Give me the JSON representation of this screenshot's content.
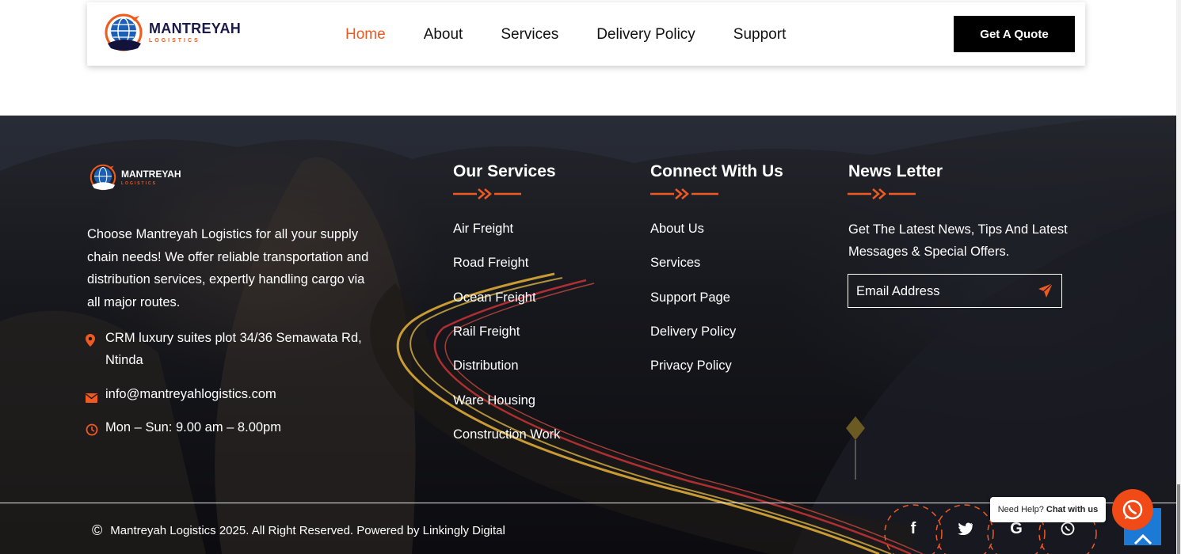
{
  "header": {
    "logo": {
      "title": "MANTREYAH",
      "subtitle": "LOGISTICS"
    },
    "nav": [
      "Home",
      "About",
      "Services",
      "Delivery Policy",
      "Support"
    ],
    "active_nav": "Home",
    "quote_button": "Get A Quote"
  },
  "footer": {
    "logo": {
      "title": "MANTREYAH",
      "subtitle": "LOGISTICS"
    },
    "about": "Choose Mantreyah Logistics for all your supply chain needs! We offer reliable transportation and distribution services, expertly handling cargo via all major routes.",
    "contact": {
      "address": "CRM luxury suites plot 34/36 Semawata Rd, Ntinda",
      "email": "info@mantreyahlogistics.com",
      "hours": "Mon – Sun: 9.00 am – 8.00pm"
    },
    "services": {
      "title": "Our Services",
      "items": [
        "Air Freight",
        "Road Freight",
        "Ocean Freight",
        "Rail Freight",
        "Distribution",
        "Ware Housing",
        "Construction Work"
      ]
    },
    "connect": {
      "title": "Connect With Us",
      "items": [
        "About Us",
        "Services",
        "Support Page",
        "Delivery Policy",
        "Privacy Policy"
      ]
    },
    "newsletter": {
      "title": "News Letter",
      "text": "Get The Latest News, Tips And Latest Messages & Special Offers.",
      "placeholder": "Email Address"
    },
    "copyright_symbol": "©",
    "copyright": "Mantreyah Logistics 2025. All Right Reserved. Powered by Linkingly Digital",
    "social": [
      "facebook-icon",
      "twitter-icon",
      "google-icon",
      "whatsapp-icon"
    ]
  },
  "chat_widget": {
    "help": "Need Help?",
    "chat": "Chat with us"
  },
  "colors": {
    "accent": "#ef5a22",
    "dark": "#000000",
    "footer_bg": "#17181d",
    "to_top": "#1c79d6"
  }
}
